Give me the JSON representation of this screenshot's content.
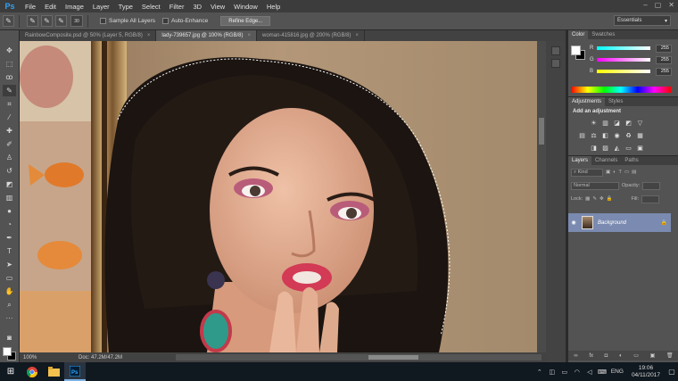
{
  "menu": {
    "logo": "Ps",
    "items": [
      "File",
      "Edit",
      "Image",
      "Layer",
      "Type",
      "Select",
      "Filter",
      "3D",
      "View",
      "Window",
      "Help"
    ],
    "window_controls": [
      "–",
      "▢",
      "✕"
    ]
  },
  "options": {
    "brush_size": "30",
    "sample_all_layers": "Sample All Layers",
    "auto_enhance": "Auto-Enhance",
    "refine_edge": "Refine Edge...",
    "workspace": "Essentials"
  },
  "tabs": [
    {
      "label": "RainbowComposite.psd @ 50% (Layer 5, RGB/8)",
      "close": "×"
    },
    {
      "label": "lady-739657.jpg @ 100% (RGB/8)",
      "close": "×"
    },
    {
      "label": "woman-415816.jpg @ 200% (RGB/8)",
      "close": "×"
    }
  ],
  "status": {
    "zoom": "100%",
    "doc": "Doc: 47.2M/47.2M"
  },
  "color_panel": {
    "tabs": [
      "Color",
      "Swatches"
    ],
    "channels": [
      {
        "label": "R",
        "value": "255"
      },
      {
        "label": "G",
        "value": "255"
      },
      {
        "label": "B",
        "value": "255"
      }
    ]
  },
  "adjustments_panel": {
    "tabs": [
      "Adjustments",
      "Styles"
    ],
    "title": "Add an adjustment"
  },
  "layers_panel": {
    "tabs": [
      "Layers",
      "Channels",
      "Paths"
    ],
    "filter": "Kind",
    "blend_mode": "Normal",
    "opacity_label": "Opacity:",
    "lock_label": "Lock:",
    "fill_label": "Fill:",
    "layers": [
      {
        "name": "Background",
        "locked": true
      }
    ],
    "bottom_icons": [
      "∞",
      "fx",
      "◘",
      "◐",
      "▭",
      "▣",
      "🗑"
    ]
  },
  "taskbar": {
    "lang": "ENG",
    "time": "19:06",
    "date": "04/11/2017"
  }
}
